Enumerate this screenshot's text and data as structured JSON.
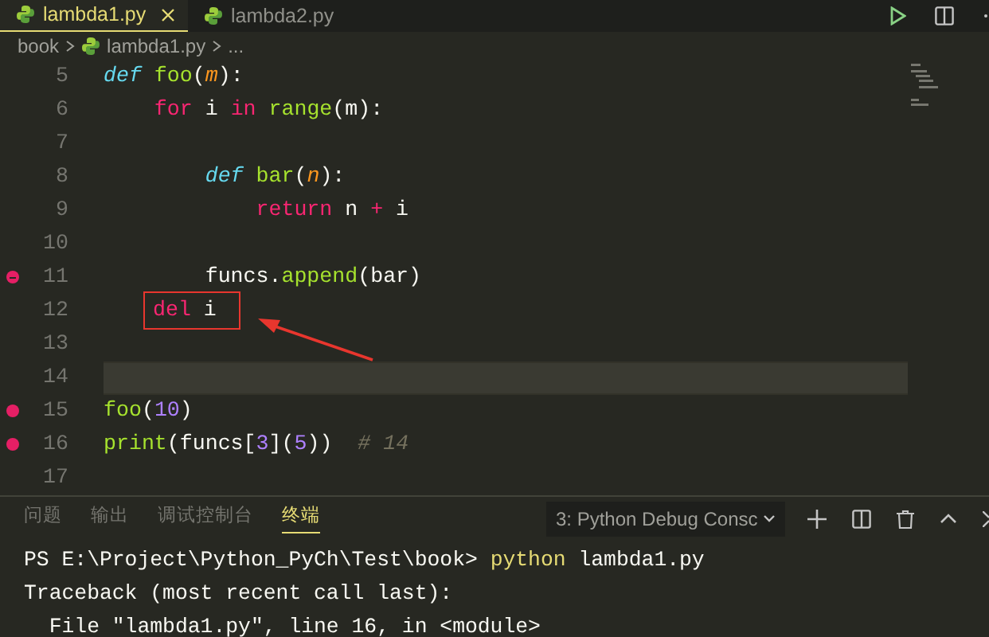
{
  "tabs": [
    {
      "label": "lambda1.py",
      "selected": true,
      "closable": true
    },
    {
      "label": "lambda2.py",
      "selected": false
    }
  ],
  "breadcrumb": {
    "folder": "book",
    "file": "lambda1.py",
    "more": "..."
  },
  "editor": {
    "lines": [
      {
        "number": "5",
        "tokens": [
          {
            "t": "def ",
            "kind": "def"
          },
          {
            "t": "foo",
            "kind": "fn"
          },
          {
            "t": "(",
            "kind": "punc"
          },
          {
            "t": "m",
            "kind": "param"
          },
          {
            "t": "):",
            "kind": "punc"
          }
        ]
      },
      {
        "number": "6",
        "tokens": [
          {
            "t": "    for",
            "kind": "kw"
          },
          {
            "t": " i ",
            "kind": "var"
          },
          {
            "t": "in",
            "kind": "kw"
          },
          {
            "t": " range",
            "kind": "fn"
          },
          {
            "t": "(",
            "kind": "punc"
          },
          {
            "t": "m",
            "kind": "var"
          },
          {
            "t": "):",
            "kind": "punc"
          }
        ]
      },
      {
        "number": "7"
      },
      {
        "number": "8",
        "tokens": [
          {
            "t": "        def ",
            "kind": "def"
          },
          {
            "t": "bar",
            "kind": "fn"
          },
          {
            "t": "(",
            "kind": "punc"
          },
          {
            "t": "n",
            "kind": "param"
          },
          {
            "t": "):",
            "kind": "punc"
          }
        ]
      },
      {
        "number": "9",
        "tokens": [
          {
            "t": "            return",
            "kind": "kw"
          },
          {
            "t": " n ",
            "kind": "var"
          },
          {
            "t": "+",
            "kind": "kw"
          },
          {
            "t": " i",
            "kind": "var"
          }
        ]
      },
      {
        "number": "10"
      },
      {
        "number": "11",
        "breakpoint": {
          "kind": "conditional"
        },
        "tokens": [
          {
            "t": "        funcs",
            "kind": "var"
          },
          {
            "t": ".",
            "kind": "punc"
          },
          {
            "t": "append",
            "kind": "fn"
          },
          {
            "t": "(",
            "kind": "punc"
          },
          {
            "t": "bar",
            "kind": "var"
          },
          {
            "t": ")",
            "kind": "punc"
          }
        ]
      },
      {
        "number": "12",
        "annotated": true,
        "tokens": [
          {
            "t": "del",
            "kind": "kw"
          },
          {
            "t": " i",
            "kind": "var"
          }
        ]
      },
      {
        "number": "13"
      },
      {
        "number": "14",
        "current": true
      },
      {
        "number": "15",
        "breakpoint": {
          "kind": "normal"
        },
        "tokens": [
          {
            "t": "foo",
            "kind": "fn"
          },
          {
            "t": "(",
            "kind": "punc"
          },
          {
            "t": "10",
            "kind": "num"
          },
          {
            "t": ")",
            "kind": "punc"
          }
        ]
      },
      {
        "number": "16",
        "breakpoint": {
          "kind": "normal"
        },
        "tokens": [
          {
            "t": "print",
            "kind": "fn"
          },
          {
            "t": "(",
            "kind": "punc"
          },
          {
            "t": "funcs",
            "kind": "var"
          },
          {
            "t": "[",
            "kind": "punc"
          },
          {
            "t": "3",
            "kind": "num"
          },
          {
            "t": "](",
            "kind": "punc"
          },
          {
            "t": "5",
            "kind": "num"
          },
          {
            "t": "))",
            "kind": "punc"
          },
          {
            "t": "  # 14",
            "kind": "cmt"
          }
        ]
      },
      {
        "number": "17"
      }
    ]
  },
  "panel": {
    "tabs": [
      {
        "label": "问题",
        "selected": false
      },
      {
        "label": "输出",
        "selected": false
      },
      {
        "label": "调试控制台",
        "selected": false
      },
      {
        "label": "终端",
        "selected": true
      }
    ],
    "terminal_select": "3: Python Debug Consc",
    "terminal": [
      [
        {
          "t": "PS E:\\Project\\Python_PyCh\\Test\\book> ",
          "kind": "plain"
        },
        {
          "t": "python",
          "kind": "cmd"
        },
        {
          "t": " lambda1.py",
          "kind": "plain"
        }
      ],
      [
        {
          "t": "Traceback (most recent call last):",
          "kind": "plain"
        }
      ],
      [
        {
          "t": "  File \"lambda1.py\", line 16, in <module>",
          "kind": "plain"
        }
      ]
    ]
  }
}
